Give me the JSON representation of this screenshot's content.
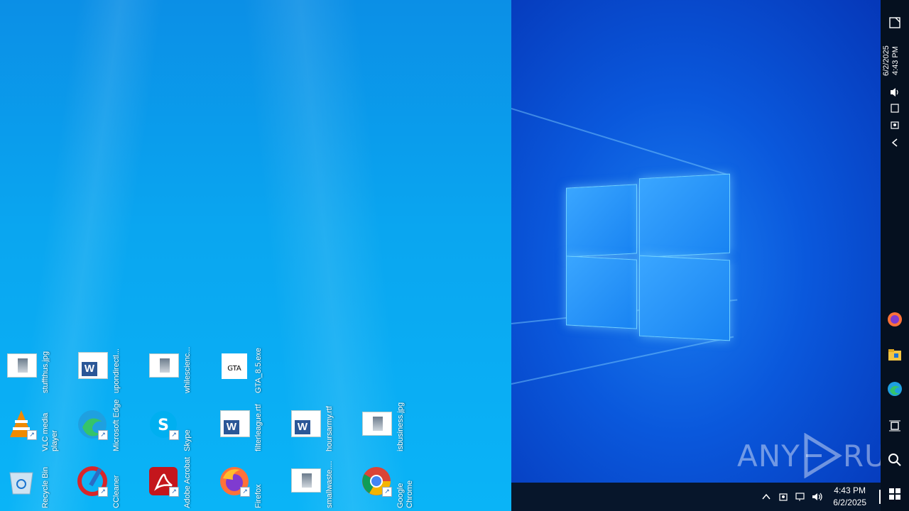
{
  "desktop": {
    "icons": [
      {
        "label": "stuffthus.jpg",
        "icon": "image-file-icon",
        "type": "image"
      },
      {
        "label": "upondirectl...",
        "icon": "word-document-icon",
        "type": "word"
      },
      {
        "label": "whilescienc...",
        "icon": "image-file-icon",
        "type": "image"
      },
      {
        "label": "GTA_8.5.exe",
        "icon": "gta-app-icon",
        "type": "gta"
      },
      {
        "label": "VLC media player",
        "icon": "vlc-icon",
        "type": "vlc"
      },
      {
        "label": "Microsoft Edge",
        "icon": "edge-icon",
        "type": "edge"
      },
      {
        "label": "Skype",
        "icon": "skype-icon",
        "type": "skype"
      },
      {
        "label": "filterleague.rtf",
        "icon": "word-document-icon",
        "type": "word"
      },
      {
        "label": "hoursarmy.rtf",
        "icon": "word-document-icon",
        "type": "word"
      },
      {
        "label": "isbusiness.jpg",
        "icon": "image-file-icon",
        "type": "image"
      },
      {
        "label": "Recycle Bin",
        "icon": "recycle-bin-icon",
        "type": "recycle"
      },
      {
        "label": "CCleaner",
        "icon": "ccleaner-icon",
        "type": "ccleaner"
      },
      {
        "label": "Adobe Acrobat",
        "icon": "acrobat-icon",
        "type": "acrobat"
      },
      {
        "label": "Firefox",
        "icon": "firefox-icon",
        "type": "firefox"
      },
      {
        "label": "smallwaste....",
        "icon": "image-file-icon",
        "type": "image"
      },
      {
        "label": "Google Chrome",
        "icon": "chrome-icon",
        "type": "chrome"
      }
    ]
  },
  "watermark": {
    "left": "ANY",
    "right": "RUN"
  },
  "taskbar": {
    "time": "4:43 PM",
    "date": "6/2/2025",
    "tray": [
      "chevron-up-icon",
      "meet-now-icon",
      "network-icon",
      "volume-icon"
    ]
  },
  "side_taskbar": {
    "time": "4:43 PM",
    "date": "6/2/2025",
    "pinned": [
      "firefox-icon",
      "file-explorer-icon",
      "edge-icon",
      "task-view-icon",
      "search-icon",
      "start-icon"
    ]
  },
  "colors": {
    "accent": "#0a58dc",
    "taskbar": "#07162b"
  }
}
